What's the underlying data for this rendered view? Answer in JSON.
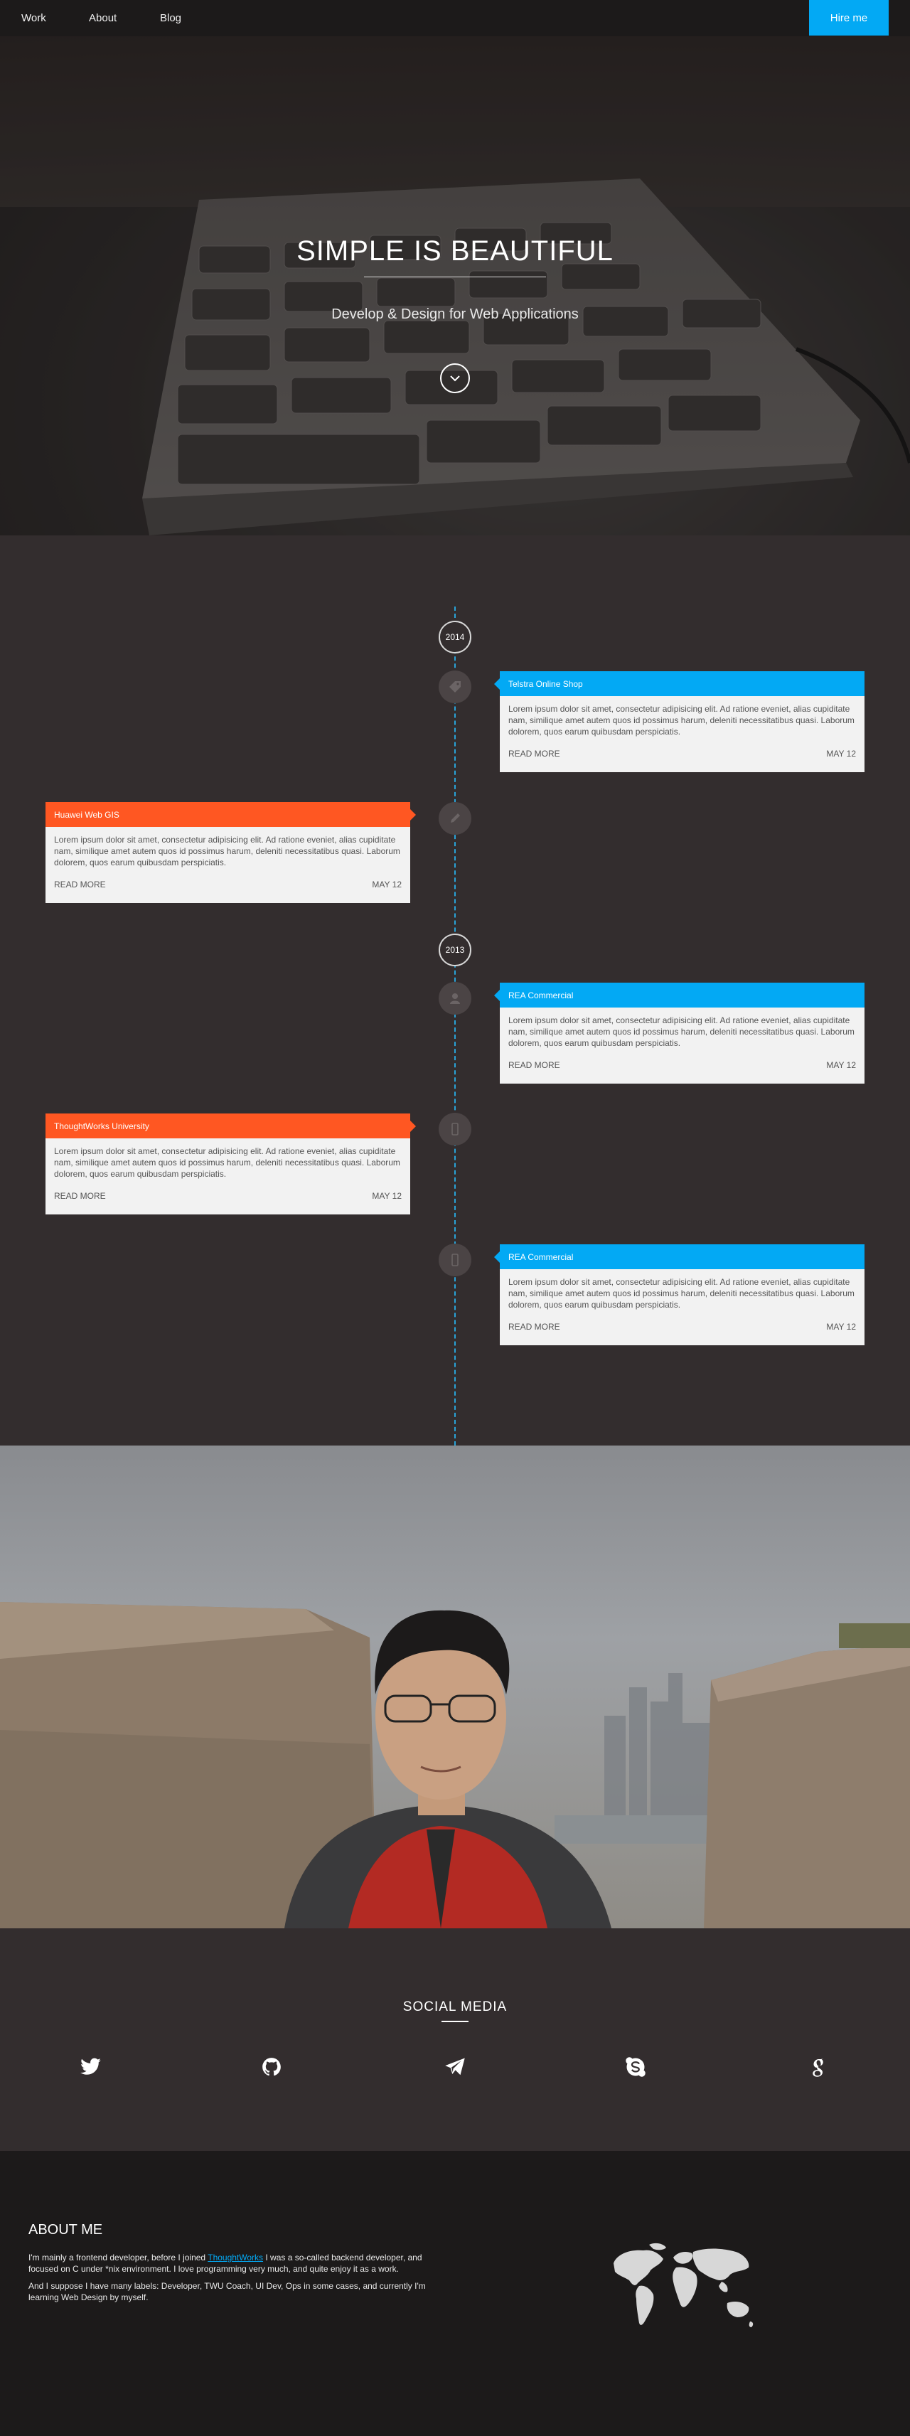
{
  "nav": {
    "items": [
      "Work",
      "About",
      "Blog"
    ],
    "hire": "Hire me"
  },
  "hero": {
    "title": "SIMPLE IS BEAUTIFUL",
    "subtitle": "Develop & Design for Web Applications",
    "scroll_icon": "chevron-down-icon"
  },
  "timeline": {
    "years": [
      "2014",
      "2013"
    ],
    "lorem": "Lorem ipsum dolor sit amet, consectetur adipisicing elit. Ad ratione eveniet, alias cupiditate nam, similique amet autem quos id possimus harum, deleniti necessitatibus quasi. Laborum dolorem, quos earum quibusdam perspiciatis.",
    "cards": [
      {
        "title": "Telstra Online Shop",
        "side": "right",
        "icon": "tag-icon",
        "read_more": "READ MORE",
        "date": "MAY 12"
      },
      {
        "title": "Huawei Web GIS",
        "side": "left",
        "icon": "pencil-icon",
        "read_more": "READ MORE",
        "date": "MAY 12"
      },
      {
        "title": "REA Commercial",
        "side": "right",
        "icon": "user-icon",
        "read_more": "READ MORE",
        "date": "MAY 12"
      },
      {
        "title": "ThoughtWorks University",
        "side": "left",
        "icon": "mobile-icon",
        "read_more": "READ MORE",
        "date": "MAY 12"
      },
      {
        "title": "REA Commercial",
        "side": "right",
        "icon": "mobile-icon",
        "read_more": "READ MORE",
        "date": "MAY 12"
      }
    ]
  },
  "social": {
    "title": "SOCIAL MEDIA",
    "icons": [
      "twitter-icon",
      "github-icon",
      "telegram-icon",
      "skype-icon",
      "google-icon"
    ]
  },
  "about": {
    "title": "ABOUT ME",
    "p1_before": "I'm mainly a frontend developer, before I joined ",
    "p1_link": "ThoughtWorks",
    "p1_after": " I was a so-called backend developer, and focused on C under *nix environment. I love programming very much, and quite enjoy it as a work.",
    "p2": "And I suppose I have many labels: Developer, TWU Coach, UI Dev, Ops in some cases, and currently I'm learning Web Design by myself.",
    "map_icon": "world-map-icon"
  },
  "colors": {
    "accent_blue": "#03a9f4",
    "accent_orange": "#ff5722",
    "dark": "#332d2e",
    "darker": "#1c1a1a"
  }
}
